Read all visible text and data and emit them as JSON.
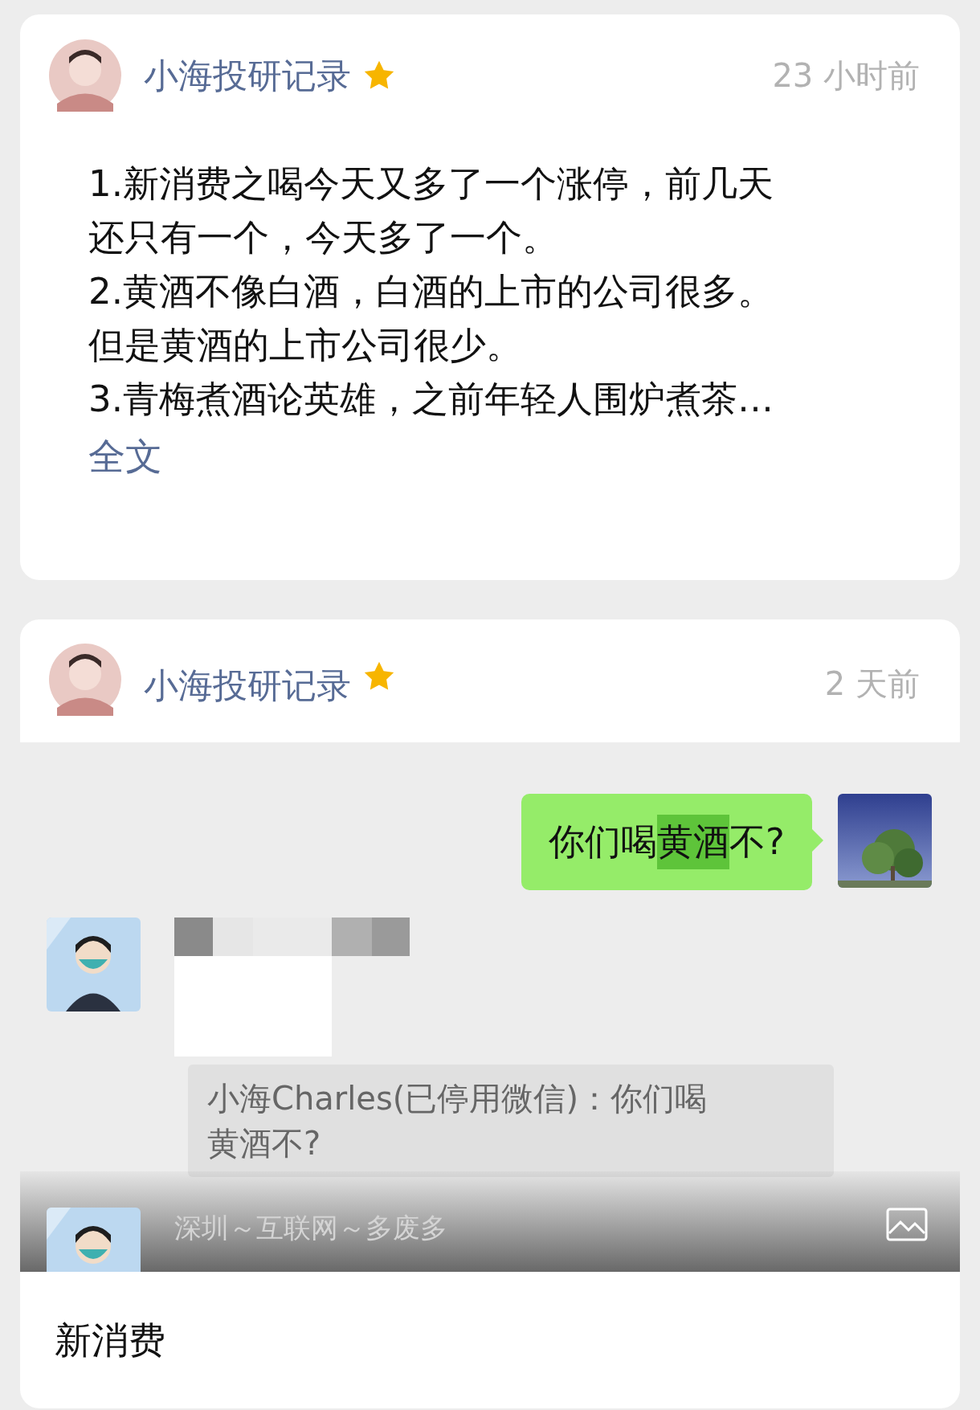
{
  "posts": [
    {
      "kind": "text",
      "author": "小海投研记录",
      "starred": true,
      "time": "23 小时前",
      "lines": [
        "1.新消费之喝今天又多了一个涨停，前几天",
        "还只有一个，今天多了一个。",
        "2.黄酒不像白酒，白酒的上市的公司很多。",
        "但是黄酒的上市公司很少。",
        "3.青梅煮酒论英雄，之前年轻人围炉煮茶…"
      ],
      "more_link": "全文"
    },
    {
      "kind": "chat",
      "author": "小海投研记录",
      "starred": true,
      "time": "2 天前",
      "chat": {
        "outgoing_parts": [
          {
            "text": "你们喝",
            "highlighted": false
          },
          {
            "text": "黄酒",
            "highlighted": true
          },
          {
            "text": "不?",
            "highlighted": false
          }
        ],
        "quote": "小海Charles(已停用微信)：你们喝黄酒不?",
        "next_sender": "深圳～互联网～多废多"
      },
      "caption": "新消费"
    }
  ]
}
